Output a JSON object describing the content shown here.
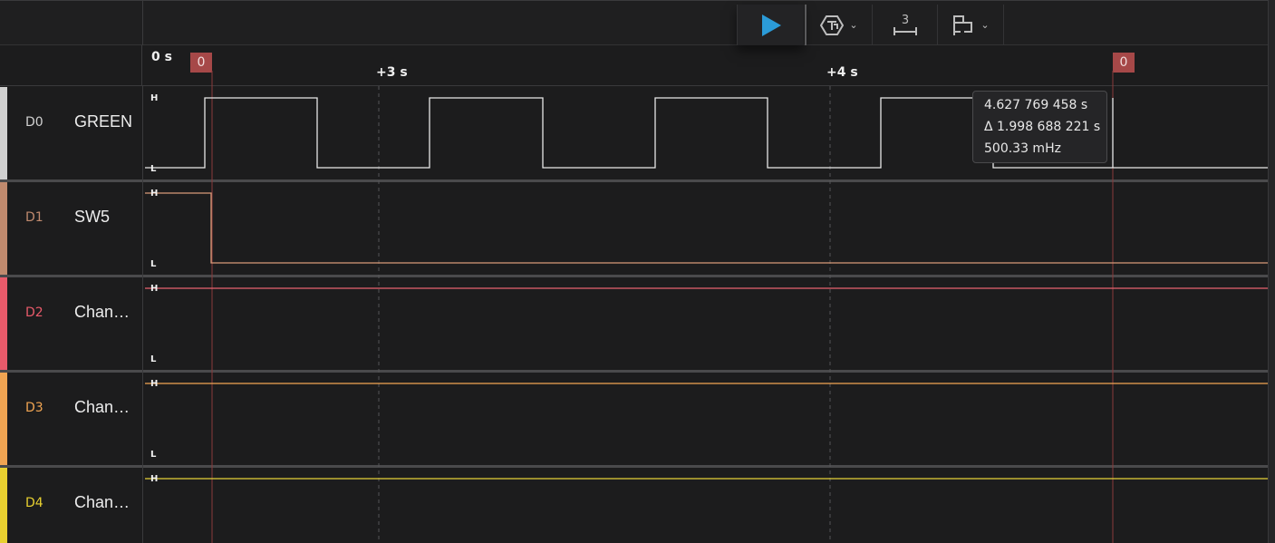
{
  "toolbar": {
    "play": {
      "icon": "play-icon",
      "color": "#2b9bd8"
    },
    "trigger": {
      "icon": "trigger-icon",
      "chevron": "⌄"
    },
    "measure": {
      "icon": "measure-icon",
      "digit": "3"
    },
    "annotations": {
      "icon": "annotation-icon",
      "chevron": "⌄"
    }
  },
  "ruler": {
    "start_label": "0 s",
    "tick_labels": [
      "+3 s",
      "+4 s"
    ],
    "marker_labels": [
      "0",
      "0"
    ]
  },
  "level_labels": {
    "high": "H",
    "low": "L"
  },
  "channels": [
    {
      "id": "D0",
      "name": "GREEN",
      "color": "#d0d0d0",
      "wave_color": "#e8e8e8"
    },
    {
      "id": "D1",
      "name": "SW5",
      "color": "#c08a6e",
      "wave_color": "#d79a78"
    },
    {
      "id": "D2",
      "name": "Chan…",
      "color": "#e85a6a",
      "wave_color": "#e8626f"
    },
    {
      "id": "D3",
      "name": "Chan…",
      "color": "#f0a452",
      "wave_color": "#f2a654"
    },
    {
      "id": "D4",
      "name": "Chan…",
      "color": "#e8d030",
      "wave_color": "#e5d23a"
    }
  ],
  "tooltip": {
    "time": "4.627 769 458 s",
    "delta": "Δ 1.998 688 221 s",
    "frequency": "500.33 mHz"
  }
}
